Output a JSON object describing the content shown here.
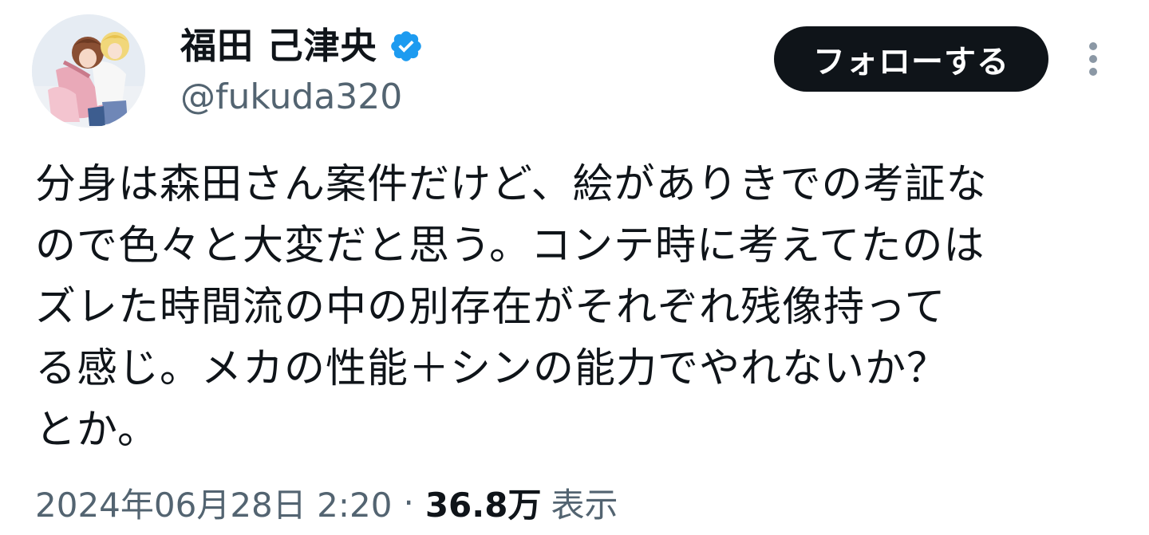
{
  "author": {
    "display_name": "福田 己津央",
    "handle": "@fukuda320",
    "verified": true
  },
  "actions": {
    "follow_label": "フォローする"
  },
  "tweet": {
    "lines": [
      "分身は森田さん案件だけど、絵がありきでの考証な",
      "ので色々と大変だと思う。コンテ時に考えてたのは",
      "ズレた時間流の中の別存在がそれぞれ残像持って",
      "る感じ。メカの性能＋シンの能力でやれないか？",
      "とか。"
    ]
  },
  "meta": {
    "timestamp": "2024年06月28日 2:20",
    "separator": "·",
    "views_count": "36.8万",
    "views_label": "表示"
  },
  "colors": {
    "text_primary": "#0f1419",
    "text_secondary": "#536471",
    "verified_blue": "#1d9bf0",
    "follow_button_bg": "#0f1419",
    "follow_button_text": "#ffffff"
  },
  "icons": {
    "verified": "verified-badge-icon",
    "more": "more-vertical-icon"
  }
}
